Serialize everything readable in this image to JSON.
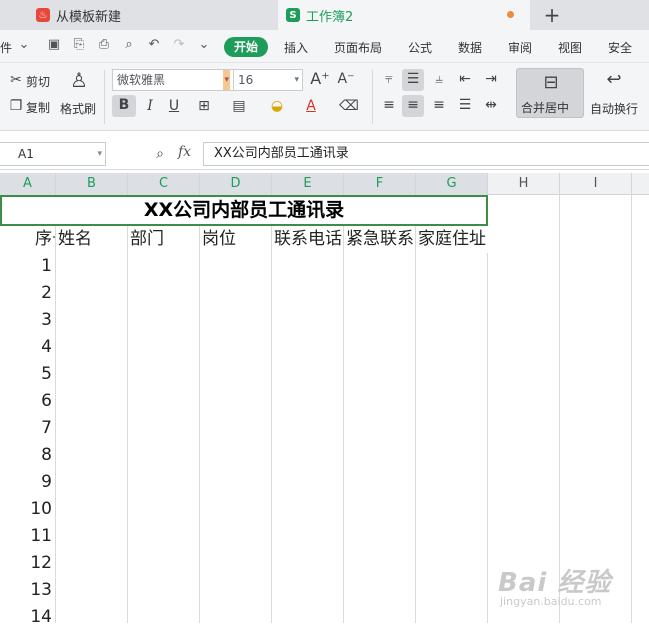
{
  "tabs": {
    "template_label": "从模板新建",
    "workbook_label": "工作簿2",
    "new_tab": "+"
  },
  "menu": {
    "file_fragment": "件",
    "items": [
      "开始",
      "插入",
      "页面布局",
      "公式",
      "数据",
      "审阅",
      "视图",
      "安全"
    ]
  },
  "ribbon": {
    "cut": "剪切",
    "copy": "复制",
    "format_painter": "格式刷",
    "font_name": "微软雅黑",
    "font_size": "16",
    "bold": "B",
    "italic": "I",
    "underline": "U",
    "merge_center": "合并居中",
    "wrap_text": "自动换行"
  },
  "formula_bar": {
    "name_box": "A1",
    "fx": "fx",
    "content": "XX公司内部员工通讯录"
  },
  "columns": [
    "A",
    "B",
    "C",
    "D",
    "E",
    "F",
    "G",
    "H",
    "I"
  ],
  "sheet": {
    "title": "XX公司内部员工通讯录",
    "headers": [
      "序号",
      "姓名",
      "部门",
      "岗位",
      "联系电话",
      "紧急联系",
      "家庭住址"
    ],
    "row_numbers": [
      "1",
      "2",
      "3",
      "4",
      "5",
      "6",
      "7",
      "8",
      "9",
      "10",
      "11",
      "12",
      "13",
      "14"
    ]
  },
  "watermark": {
    "text": "Bai 经验",
    "sub": "jingyan.baidu.com"
  },
  "colors": {
    "accent": "#1e9d5a",
    "selection_border": "#3c8d48",
    "unsaved_dot": "#f08a3c"
  }
}
